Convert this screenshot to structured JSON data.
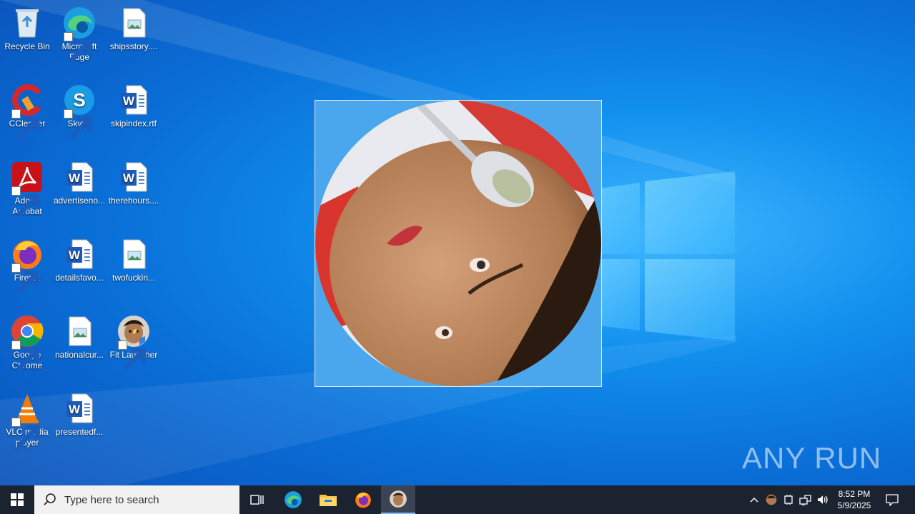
{
  "desktop": {
    "icons": [
      {
        "label": "Recycle Bin",
        "icon": "recycle-bin-icon"
      },
      {
        "label": "Microsoft Edge",
        "icon": "edge-icon"
      },
      {
        "label": "shipsstory....",
        "icon": "image-file-icon"
      },
      {
        "label": "CCleaner",
        "icon": "ccleaner-icon"
      },
      {
        "label": "Skype",
        "icon": "skype-icon"
      },
      {
        "label": "skipindex.rtf",
        "icon": "word-doc-icon"
      },
      {
        "label": "Adobe Acrobat",
        "icon": "acrobat-icon"
      },
      {
        "label": "advertiseno...",
        "icon": "word-doc-icon"
      },
      {
        "label": "therehours....",
        "icon": "word-doc-icon"
      },
      {
        "label": "Firefox",
        "icon": "firefox-icon"
      },
      {
        "label": "detailsfavo...",
        "icon": "word-doc-icon"
      },
      {
        "label": "twofuckin...",
        "icon": "image-file-icon"
      },
      {
        "label": "Google Chrome",
        "icon": "chrome-icon"
      },
      {
        "label": "nationalcur...",
        "icon": "image-file-icon"
      },
      {
        "label": "Fit Launcher",
        "icon": "fit-launcher-icon"
      },
      {
        "label": "VLC media player",
        "icon": "vlc-icon"
      },
      {
        "label": "presentedf...",
        "icon": "word-doc-icon"
      }
    ]
  },
  "watermark": {
    "text": "ANY RUN"
  },
  "taskbar": {
    "search_placeholder": "Type here to search",
    "pinned": [
      "task-view-icon",
      "edge-icon",
      "file-explorer-icon",
      "firefox-icon",
      "fit-launcher-icon"
    ],
    "clock_time": "8:52 PM",
    "clock_date": "5/9/2025"
  },
  "colors": {
    "desktop_blue": "#0a78e0",
    "taskbar": "#1b2330"
  }
}
